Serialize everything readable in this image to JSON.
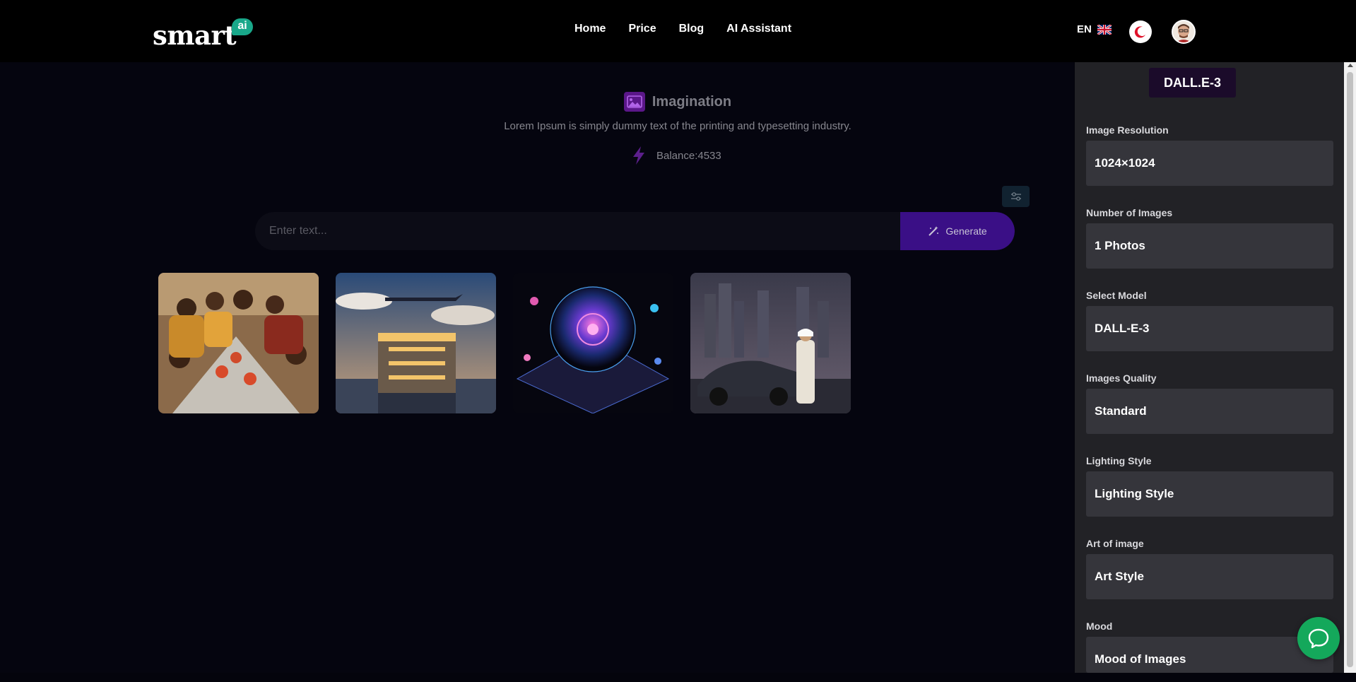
{
  "header": {
    "logo_text": "smart",
    "logo_badge": "ai",
    "nav": [
      "Home",
      "Price",
      "Blog",
      "AI Assistant"
    ],
    "lang": "EN"
  },
  "hero": {
    "title": "Imagination",
    "subtitle": "Lorem Ipsum is simply dummy text of the printing and typesetting industry.",
    "balance": "Balance:4533"
  },
  "prompt": {
    "placeholder": "Enter text...",
    "generate_label": "Generate"
  },
  "gallery": [
    {
      "name": "people-dining-image"
    },
    {
      "name": "city-airplane-image"
    },
    {
      "name": "digital-globe-image"
    },
    {
      "name": "car-city-image"
    }
  ],
  "panel": {
    "model_badge": "DALL.E-3",
    "fields": [
      {
        "label": "Image Resolution",
        "value": "1024×1024"
      },
      {
        "label": "Number of Images",
        "value": "1 Photos"
      },
      {
        "label": "Select Model",
        "value": "DALL-E-3"
      },
      {
        "label": "Images Quality",
        "value": "Standard"
      },
      {
        "label": "Lighting Style",
        "value": "Lighting Style"
      },
      {
        "label": "Art of image",
        "value": "Art Style"
      },
      {
        "label": "Mood",
        "value": "Mood of Images"
      }
    ]
  },
  "colors": {
    "accent": "#3a0f86",
    "logo_badge": "#19a88a",
    "chat": "#14a85b"
  }
}
